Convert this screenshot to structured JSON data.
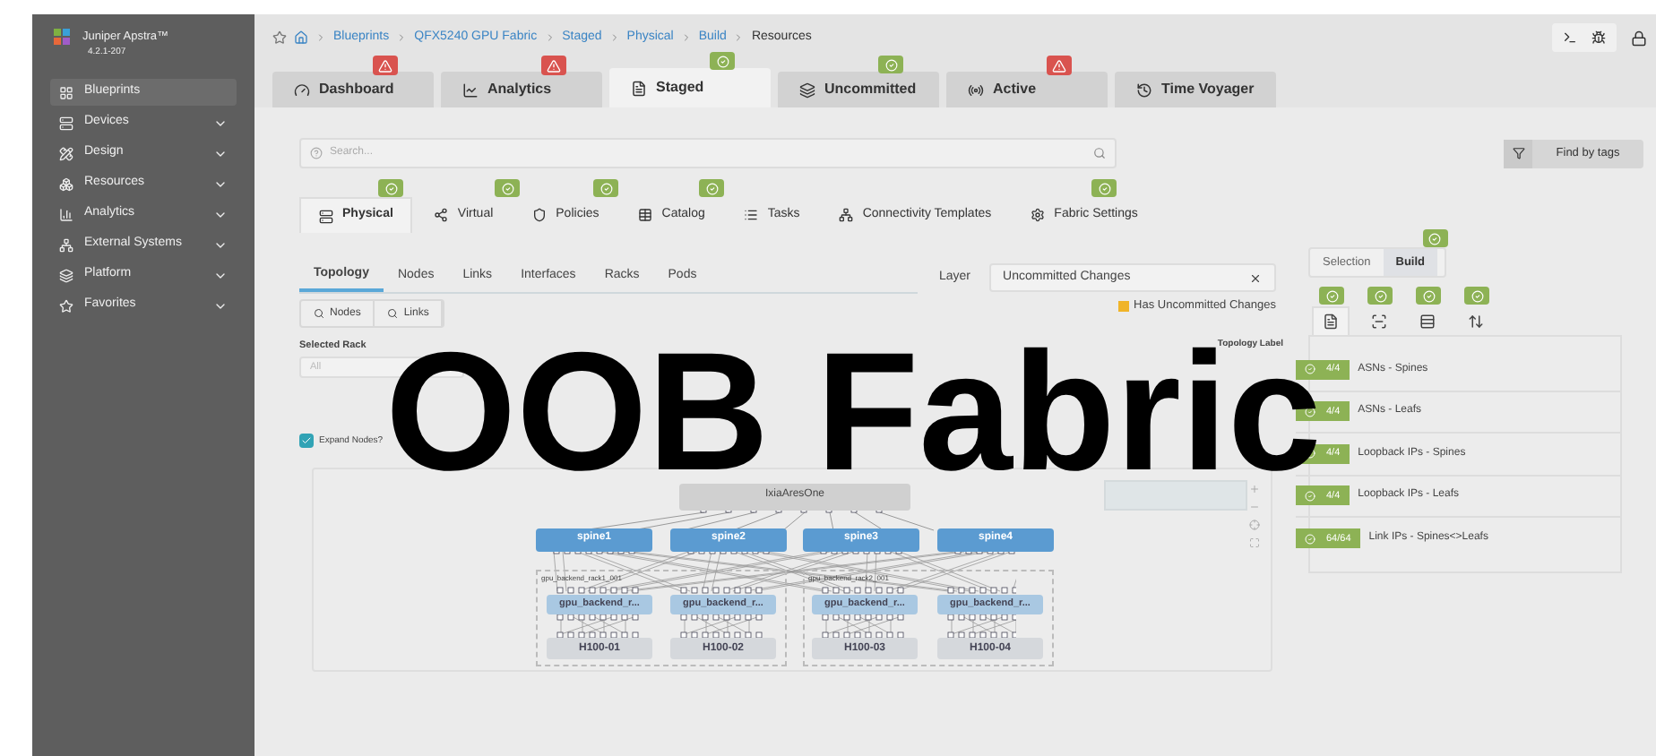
{
  "sidebar": {
    "product": "Juniper Apstra™",
    "version": "4.2.1-207",
    "items": [
      {
        "label": "Blueprints",
        "selected": true,
        "expandable": false
      },
      {
        "label": "Devices",
        "selected": false,
        "expandable": true
      },
      {
        "label": "Design",
        "selected": false,
        "expandable": true
      },
      {
        "label": "Resources",
        "selected": false,
        "expandable": true
      },
      {
        "label": "Analytics",
        "selected": false,
        "expandable": true
      },
      {
        "label": "External Systems",
        "selected": false,
        "expandable": true
      },
      {
        "label": "Platform",
        "selected": false,
        "expandable": true
      },
      {
        "label": "Favorites",
        "selected": false,
        "expandable": true
      }
    ]
  },
  "breadcrumb": [
    "Blueprints",
    "QFX5240 GPU Fabric",
    "Staged",
    "Physical",
    "Build",
    "Resources"
  ],
  "tabs": [
    {
      "label": "Dashboard",
      "selected": false,
      "warning": true,
      "validated": false
    },
    {
      "label": "Analytics",
      "selected": false,
      "warning": true,
      "validated": false
    },
    {
      "label": "Staged",
      "selected": true,
      "warning": false,
      "validated": true
    },
    {
      "label": "Uncommitted",
      "selected": false,
      "warning": false,
      "validated": true
    },
    {
      "label": "Active",
      "selected": false,
      "warning": true,
      "validated": false
    },
    {
      "label": "Time Voyager",
      "selected": false,
      "warning": false,
      "validated": false
    }
  ],
  "search": {
    "placeholder": "Search..."
  },
  "find_by_tags": "Find by tags",
  "subtabs": [
    {
      "label": "Physical",
      "selected": true,
      "validated": true
    },
    {
      "label": "Virtual",
      "selected": false,
      "validated": true
    },
    {
      "label": "Policies",
      "selected": false,
      "validated": true
    },
    {
      "label": "Catalog",
      "selected": false,
      "validated": true
    },
    {
      "label": "Tasks",
      "selected": false,
      "validated": false
    },
    {
      "label": "Connectivity Templates",
      "selected": false,
      "validated": false
    },
    {
      "label": "Fabric Settings",
      "selected": false,
      "validated": true
    }
  ],
  "view_tabs": [
    {
      "label": "Topology",
      "selected": true
    },
    {
      "label": "Nodes",
      "selected": false
    },
    {
      "label": "Links",
      "selected": false
    },
    {
      "label": "Interfaces",
      "selected": false
    },
    {
      "label": "Racks",
      "selected": false
    },
    {
      "label": "Pods",
      "selected": false
    }
  ],
  "layer": {
    "label": "Layer",
    "value": "Uncommitted Changes"
  },
  "search_buttons": [
    "Nodes",
    "Links"
  ],
  "legend": {
    "label": "Has Uncommitted Changes",
    "color": "#f0b429"
  },
  "selected_rack": {
    "label": "Selected Rack",
    "value": "All"
  },
  "topology_label": "Topology Label",
  "expand_nodes": {
    "label": "Expand Nodes?",
    "checked": true
  },
  "diagram": {
    "generator": "IxiaAresOne",
    "spines": [
      "spine1",
      "spine2",
      "spine3",
      "spine4"
    ],
    "racks": [
      {
        "label": "gpu_backend_rack1_001",
        "leafs": [
          "gpu_backend_r...",
          "gpu_backend_r..."
        ],
        "servers": [
          "H100-01",
          "H100-02"
        ]
      },
      {
        "label": "gpu_backend_rack2_001",
        "leafs": [
          "gpu_backend_r...",
          "gpu_backend_r..."
        ],
        "servers": [
          "H100-03",
          "H100-04"
        ]
      }
    ]
  },
  "mode_toggle": [
    {
      "label": "Selection",
      "selected": false,
      "validated": false
    },
    {
      "label": "Build",
      "selected": true,
      "validated": true
    }
  ],
  "build_tools": [
    {
      "kind": "list",
      "selected": true,
      "validated": true
    },
    {
      "kind": "nodes",
      "selected": false,
      "validated": true
    },
    {
      "kind": "stack",
      "selected": false,
      "validated": true
    },
    {
      "kind": "sort",
      "selected": false,
      "validated": true
    }
  ],
  "resources": [
    {
      "count": "4/4",
      "label": "ASNs - Spines"
    },
    {
      "count": "4/4",
      "label": "ASNs - Leafs"
    },
    {
      "count": "4/4",
      "label": "Loopback IPs - Spines"
    },
    {
      "count": "4/4",
      "label": "Loopback IPs - Leafs"
    },
    {
      "count": "64/64",
      "label": "Link IPs - Spines<>Leafs"
    }
  ],
  "overlay_title": "OOB Fabric"
}
